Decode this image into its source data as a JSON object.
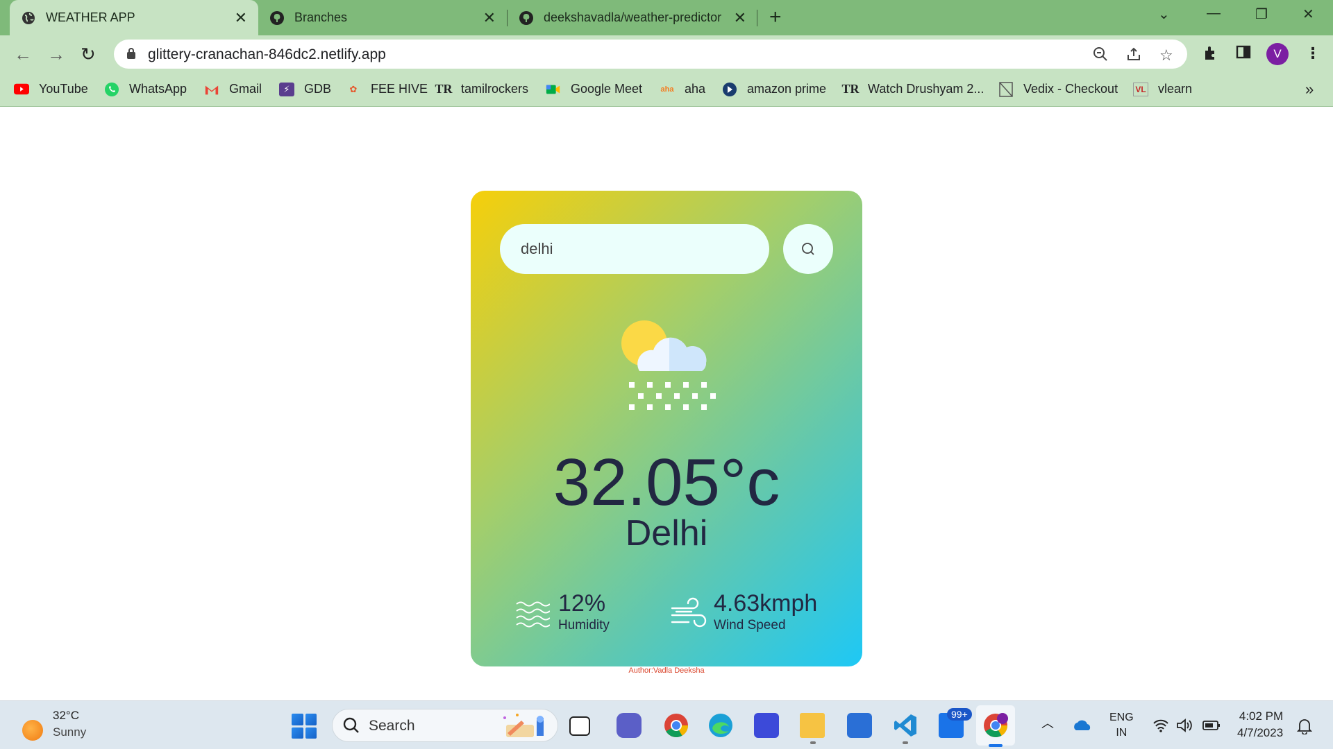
{
  "browser": {
    "tabs": [
      {
        "label": "WEATHER APP",
        "icon": "globe-icon"
      },
      {
        "label": "Branches",
        "icon": "github-icon"
      },
      {
        "label": "deekshavadla/weather-predictor",
        "icon": "github-icon"
      }
    ],
    "url": "glittery-cranachan-846dc2.netlify.app",
    "profile_initial": "V",
    "bookmarks": [
      {
        "label": "YouTube",
        "icon": "youtube-icon"
      },
      {
        "label": "WhatsApp",
        "icon": "whatsapp-icon"
      },
      {
        "label": "Gmail",
        "icon": "gmail-icon"
      },
      {
        "label": "GDB",
        "icon": "gdb-icon"
      },
      {
        "label": "FEE HIVE",
        "icon": "feehive-icon"
      },
      {
        "label": "tamilrockers",
        "icon": "tr-icon"
      },
      {
        "label": "Google Meet",
        "icon": "meet-icon"
      },
      {
        "label": "aha",
        "icon": "aha-icon"
      },
      {
        "label": "amazon prime",
        "icon": "prime-icon"
      },
      {
        "label": "Watch Drushyam 2...",
        "icon": "tr-icon"
      },
      {
        "label": "Vedix - Checkout",
        "icon": "page-icon"
      },
      {
        "label": "vlearn",
        "icon": "vlearn-icon"
      }
    ]
  },
  "weather": {
    "search_value": "delhi",
    "temperature": "32.05°c",
    "city": "Delhi",
    "humidity_value": "12%",
    "humidity_label": "Humidity",
    "wind_value": "4.63kmph",
    "wind_label": "Wind Speed",
    "author": "Author:Vadla Deeksha",
    "condition_icon": "rain-cloud-sun-icon"
  },
  "taskbar": {
    "weather_temp": "32°C",
    "weather_desc": "Sunny",
    "search_label": "Search",
    "mail_badge": "99+",
    "lang_1": "ENG",
    "lang_2": "IN",
    "time": "4:02 PM",
    "date": "4/7/2023"
  },
  "colors": {
    "tab_strip": "#7fba7a",
    "toolbar": "#c7e3c3",
    "card_gradient_start": "#f6cf0a",
    "card_gradient_end": "#1ec8f5",
    "text_dark": "#222742"
  }
}
